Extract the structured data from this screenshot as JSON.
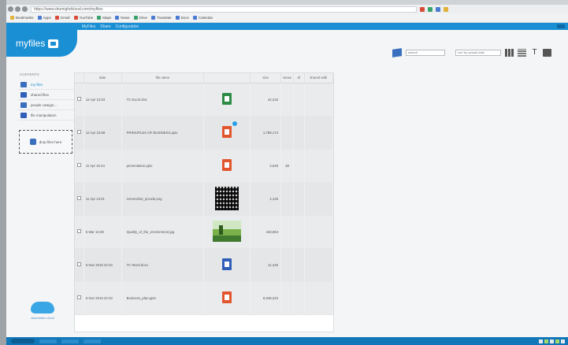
{
  "browser": {
    "url": "https://www.drumighdcloud.com/myfiles",
    "bookmarks": [
      "Bookmarks",
      "Apps",
      "Gmail",
      "YouTube",
      "Maps",
      "News",
      "Drive",
      "Translate",
      "Docs",
      "Calendar"
    ]
  },
  "app": {
    "logo_text": "myfiles",
    "menu": [
      "MyFiles",
      "Share",
      "Configuration"
    ],
    "brand_color": "#1a8fd4"
  },
  "toolbar": {
    "search_placeholder": "search",
    "sort_value": "sort by upload date"
  },
  "sidebar": {
    "heading": "CONTENTS",
    "items": [
      {
        "label": "my files",
        "icon": "grid-icon"
      },
      {
        "label": "shared files",
        "icon": "globe-icon"
      },
      {
        "label": "people categor...",
        "icon": "people-icon"
      },
      {
        "label": "file manipulation",
        "icon": "check-icon"
      }
    ],
    "drop_zone_label": "drop files here"
  },
  "table": {
    "headers": [
      "date",
      "file name",
      "",
      "size",
      "views",
      "dl",
      "shared with"
    ],
    "rows": [
      {
        "date": "12 Apr 13:53",
        "name": "TC Excel.xlsx",
        "thumb": "sheet",
        "size": "44,215",
        "views": "",
        "badge": false
      },
      {
        "date": "12 Apr 10:58",
        "name": "PRINCIPLES OF BUSINESS.pptx",
        "thumb": "pdf",
        "size": "1,788,174",
        "views": "",
        "badge": true
      },
      {
        "date": "11 Apr 16:34",
        "name": "presentation.pptx",
        "thumb": "pdf",
        "size": "3,648",
        "views": "38",
        "badge": false
      },
      {
        "date": "11 Apr 13:01",
        "name": "screenshot_qrcode.png",
        "thumb": "qr",
        "size": "4,125",
        "views": "",
        "badge": false
      },
      {
        "date": "6 Mar 13:38",
        "name": "Quality_of_the_environment.jpg",
        "thumb": "image",
        "size": "448,963",
        "views": "",
        "badge": false
      },
      {
        "date": "6 Nov 2016 22:33",
        "name": "TC Word.docx",
        "thumb": "word",
        "size": "11,245",
        "views": "",
        "badge": false
      },
      {
        "date": "6 Nov 2016 22:33",
        "name": "Business_plan.pptx",
        "thumb": "pdf",
        "size": "8,638,343",
        "views": "",
        "badge": false
      }
    ]
  },
  "footer": {
    "cloud_logo_text": "dawnsides cloud"
  }
}
